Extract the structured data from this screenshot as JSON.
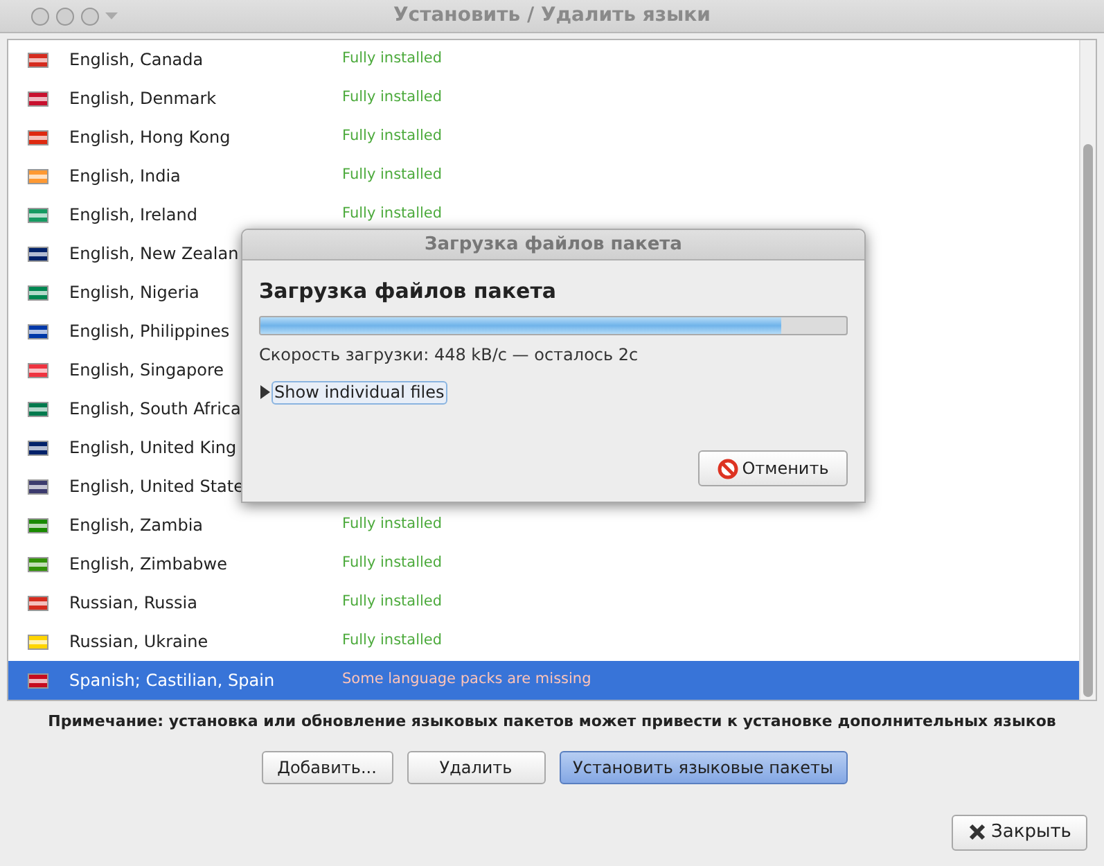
{
  "window": {
    "title": "Установить / Удалить языки"
  },
  "languages": [
    {
      "name": "English, Canada",
      "status": "Fully installed",
      "kind": "installed",
      "color": "#d52b1e",
      "selected": false
    },
    {
      "name": "English, Denmark",
      "status": "Fully installed",
      "kind": "installed",
      "color": "#c8102e",
      "selected": false
    },
    {
      "name": "English, Hong Kong",
      "status": "Fully installed",
      "kind": "installed",
      "color": "#de2910",
      "selected": false
    },
    {
      "name": "English, India",
      "status": "Fully installed",
      "kind": "installed",
      "color": "#ff9933",
      "selected": false
    },
    {
      "name": "English, Ireland",
      "status": "Fully installed",
      "kind": "installed",
      "color": "#169b62",
      "selected": false
    },
    {
      "name": "English, New Zealan",
      "kind": "hidden",
      "color": "#012169",
      "selected": false
    },
    {
      "name": "English, Nigeria",
      "kind": "hidden",
      "color": "#008751",
      "selected": false
    },
    {
      "name": "English, Philippines",
      "kind": "hidden",
      "color": "#0038a8",
      "selected": false
    },
    {
      "name": "English, Singapore",
      "kind": "hidden",
      "color": "#ef3340",
      "selected": false
    },
    {
      "name": "English, South Africa",
      "kind": "hidden",
      "color": "#007a4d",
      "selected": false
    },
    {
      "name": "English, United King",
      "kind": "hidden",
      "color": "#012169",
      "selected": false
    },
    {
      "name": "English, United State",
      "kind": "hidden",
      "color": "#3c3b6e",
      "selected": false
    },
    {
      "name": "English, Zambia",
      "status": "Fully installed",
      "kind": "installed",
      "color": "#198a00",
      "selected": false
    },
    {
      "name": "English, Zimbabwe",
      "status": "Fully installed",
      "kind": "installed",
      "color": "#319208",
      "selected": false
    },
    {
      "name": "Russian, Russia",
      "status": "Fully installed",
      "kind": "installed",
      "color": "#d52b1e",
      "selected": false
    },
    {
      "name": "Russian, Ukraine",
      "status": "Fully installed",
      "kind": "installed",
      "color": "#ffd500",
      "selected": false
    },
    {
      "name": "Spanish; Castilian, Spain",
      "status": "Some language packs are missing",
      "kind": "missing",
      "color": "#c60b1e",
      "selected": true
    }
  ],
  "note": "Примечание: установка или обновление языковых пакетов может привести к установке дополнительных языков",
  "buttons": [
    {
      "label": "Добавить...",
      "default": false
    },
    {
      "label": "Удалить",
      "default": false
    },
    {
      "label": "Установить языковые пакеты",
      "default": true
    }
  ],
  "close_button": "Закрыть",
  "dialog": {
    "title": "Загрузка файлов пакета",
    "heading": "Загрузка файлов пакета",
    "level": 0.89,
    "speed": "Скорость загрузки: 448 kB/c — осталось 2c",
    "expander": {
      "label": "Show individual files",
      "expanded": false
    },
    "cancel": "Отменить"
  }
}
